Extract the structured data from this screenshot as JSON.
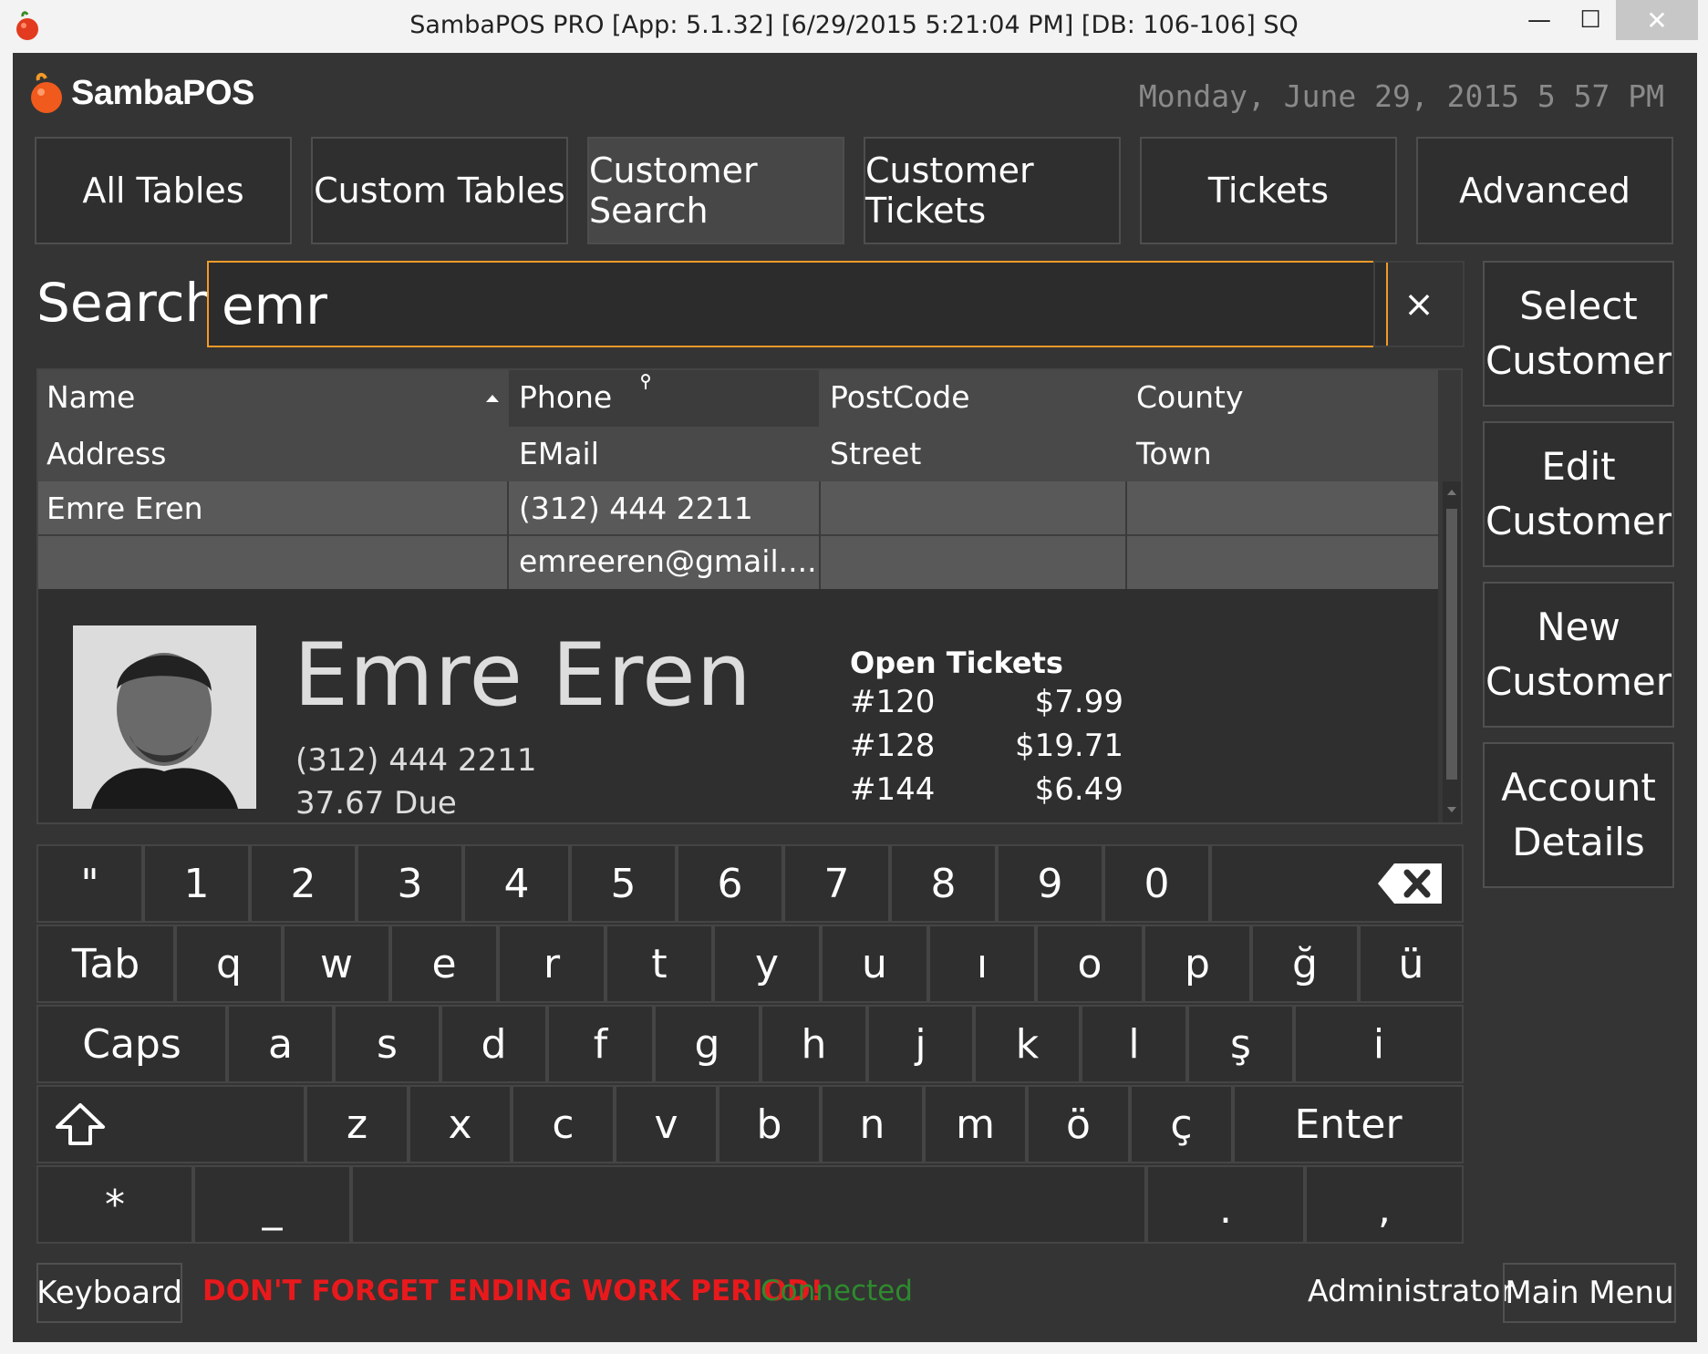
{
  "window": {
    "title": "SambaPOS PRO [App: 5.1.32] [6/29/2015 5:21:04 PM] [DB: 106-106] SQ",
    "minimize": "—",
    "maximize": "☐",
    "close": "✕"
  },
  "header": {
    "logo_text": "SambaPOS",
    "clock": "Monday, June 29, 2015 5 57 PM"
  },
  "nav": {
    "all_tables": "All Tables",
    "custom_tables": "Custom Tables",
    "customer_search": "Customer Search",
    "customer_tickets": "Customer Tickets",
    "tickets": "Tickets",
    "advanced": "Advanced"
  },
  "search": {
    "label": "Search",
    "value": "emr",
    "clear": "×"
  },
  "side_buttons": {
    "select_customer_1": "Select",
    "select_customer_2": "Customer",
    "edit_customer_1": "Edit",
    "edit_customer_2": "Customer",
    "new_customer_1": "New",
    "new_customer_2": "Customer",
    "account_details_1": "Account",
    "account_details_2": "Details"
  },
  "grid": {
    "headers": {
      "name": "Name",
      "phone": "Phone",
      "postcode": "PostCode",
      "county": "County",
      "address": "Address",
      "email": "EMail",
      "street": "Street",
      "town": "Town"
    },
    "rows": [
      {
        "name": "Emre Eren",
        "phone": "(312) 444 2211",
        "postcode": "",
        "county": "",
        "address": "",
        "email": "emreeren@gmail....",
        "street": "",
        "town": ""
      }
    ]
  },
  "detail": {
    "name": "Emre Eren",
    "phone": "(312) 444 2211",
    "due": "37.67 Due",
    "open_tickets_title": "Open Tickets",
    "open_tickets": [
      {
        "id": "#120",
        "amount": "$7.99"
      },
      {
        "id": "#128",
        "amount": "$19.71"
      },
      {
        "id": "#144",
        "amount": "$6.49"
      }
    ]
  },
  "keyboard": {
    "row1": [
      "\"",
      "1",
      "2",
      "3",
      "4",
      "5",
      "6",
      "7",
      "8",
      "9",
      "0"
    ],
    "row2": [
      "Tab",
      "q",
      "w",
      "e",
      "r",
      "t",
      "y",
      "u",
      "ı",
      "o",
      "p",
      "ğ",
      "ü"
    ],
    "row3": [
      "Caps",
      "a",
      "s",
      "d",
      "f",
      "g",
      "h",
      "j",
      "k",
      "l",
      "ş",
      "i"
    ],
    "row4": [
      "z",
      "x",
      "c",
      "v",
      "b",
      "n",
      "m",
      "ö",
      "ç",
      "Enter"
    ],
    "row5": [
      "*",
      "_",
      "",
      ".",
      ","
    ]
  },
  "footer": {
    "keyboard": "Keyboard",
    "warning": "DON'T FORGET ENDING WORK PERIOD!",
    "status": "Connected",
    "user": "Administrator",
    "main_menu": "Main Menu"
  }
}
